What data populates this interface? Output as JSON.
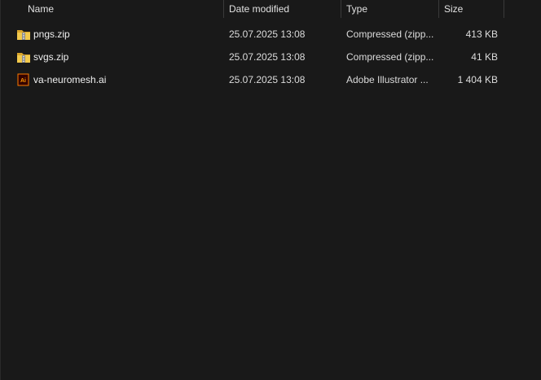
{
  "columns": {
    "name": "Name",
    "date_modified": "Date modified",
    "type": "Type",
    "size": "Size"
  },
  "files": [
    {
      "name": "pngs.zip",
      "date_modified": "25.07.2025 13:08",
      "type": "Compressed (zipp...",
      "size": "413 KB",
      "icon": "zip-folder-icon"
    },
    {
      "name": "svgs.zip",
      "date_modified": "25.07.2025 13:08",
      "type": "Compressed (zipp...",
      "size": "41 KB",
      "icon": "zip-folder-icon"
    },
    {
      "name": "va-neuromesh.ai",
      "date_modified": "25.07.2025 13:08",
      "type": "Adobe Illustrator ...",
      "size": "1 404 KB",
      "icon": "adobe-illustrator-icon"
    }
  ],
  "colors": {
    "background": "#191919",
    "folder_yellow": "#e8b93a",
    "illustrator_orange": "#ff7c00"
  }
}
